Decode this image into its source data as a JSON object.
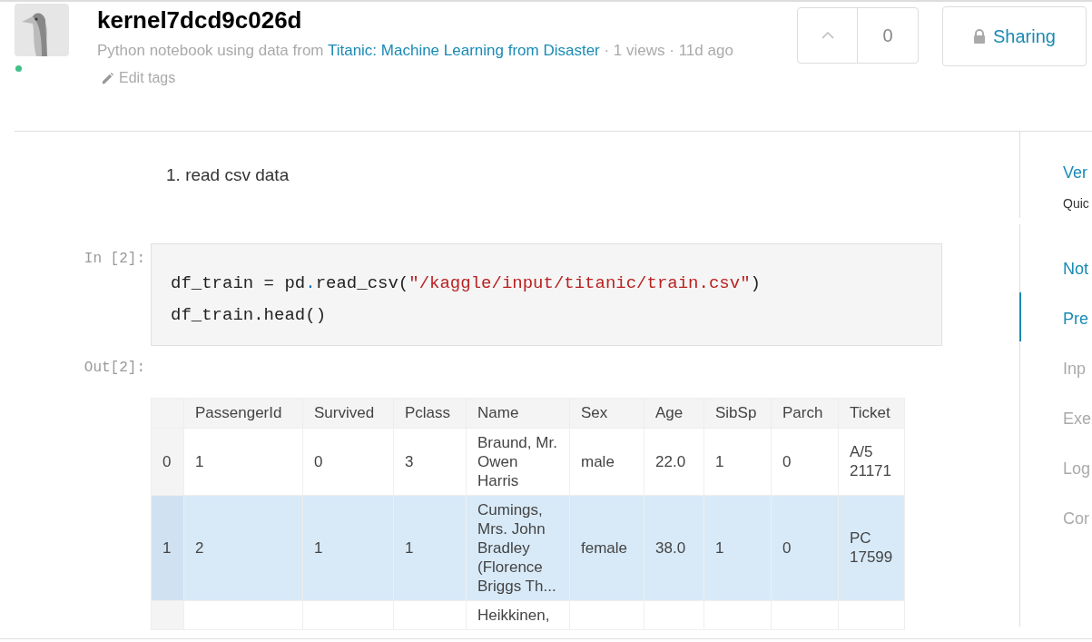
{
  "header": {
    "title": "kernel7dcd9c026d",
    "online": true,
    "subtitle_prefix": "Python notebook using data from ",
    "dataset_link": "Titanic: Machine Learning from Disaster",
    "subtitle_suffix": " · 1 views · 11d ago",
    "edit_tags": "Edit tags",
    "votes": "0",
    "sharing": "Sharing"
  },
  "markdown": {
    "items": [
      "read csv data"
    ],
    "marker": "1."
  },
  "cell": {
    "prompt": "In [2]:",
    "out_prompt": "Out[2]:",
    "lines": [
      [
        {
          "kind": "plain",
          "text": "df_train = pd"
        },
        {
          "kind": "op",
          "text": "."
        },
        {
          "kind": "plain",
          "text": "read_csv("
        },
        {
          "kind": "string",
          "text": "\"/kaggle/input/titanic/train.csv\""
        },
        {
          "kind": "plain",
          "text": ")"
        }
      ],
      [
        {
          "kind": "plain",
          "text": "df_train.head()"
        }
      ]
    ]
  },
  "table": {
    "columns": [
      "",
      "PassengerId",
      "Survived",
      "Pclass",
      "Name",
      "Sex",
      "Age",
      "SibSp",
      "Parch",
      "Ticket"
    ],
    "rows": [
      {
        "selected": false,
        "cells": [
          "0",
          "1",
          "0",
          "3",
          "Braund, Mr. Owen Harris",
          "male",
          "22.0",
          "1",
          "0",
          "A/5 21171"
        ]
      },
      {
        "selected": true,
        "cells": [
          "1",
          "2",
          "1",
          "1",
          "Cumings, Mrs. John Bradley (Florence Briggs Th...",
          "female",
          "38.0",
          "1",
          "0",
          "PC 17599"
        ]
      },
      {
        "selected": false,
        "cells": [
          "",
          "",
          "",
          "",
          "Heikkinen,",
          "",
          "",
          "",
          "",
          ""
        ]
      }
    ]
  },
  "side_panel": {
    "sections": [
      {
        "items": [
          {
            "kind": "link",
            "text": "Ver",
            "selected": false
          },
          {
            "kind": "note",
            "text": "Quic",
            "selected": false
          }
        ]
      },
      {
        "items": [
          {
            "kind": "link",
            "text": "Not",
            "selected": false
          },
          {
            "kind": "link",
            "text": "Pre",
            "selected": true
          },
          {
            "kind": "muted",
            "text": "Inp",
            "selected": false
          },
          {
            "kind": "muted",
            "text": "Exe",
            "selected": false
          },
          {
            "kind": "muted",
            "text": "Log",
            "selected": false
          },
          {
            "kind": "muted",
            "text": "Cor",
            "selected": false
          }
        ]
      }
    ]
  }
}
